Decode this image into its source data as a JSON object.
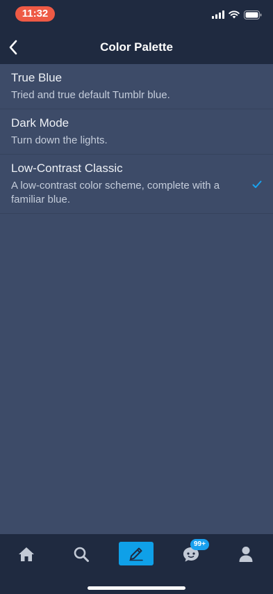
{
  "status_bar": {
    "time": "11:32",
    "icons": [
      "signal-icon",
      "wifi-icon",
      "battery-icon"
    ]
  },
  "nav": {
    "back_icon": "chevron-left-icon",
    "title": "Color Palette"
  },
  "options": [
    {
      "title": "True Blue",
      "description": "Tried and true default Tumblr blue.",
      "selected": false
    },
    {
      "title": "Dark Mode",
      "description": "Turn down the lights.",
      "selected": false
    },
    {
      "title": "Low-Contrast Classic",
      "description": "A low-contrast color scheme, complete with a familiar blue.",
      "selected": true
    }
  ],
  "tab_bar": {
    "tabs": [
      "home-icon",
      "search-icon",
      "compose-icon",
      "activity-icon",
      "account-icon"
    ],
    "activity_badge": "99+"
  },
  "colors": {
    "background": "#3d4b68",
    "bars": "#1f2a40",
    "accent": "#0fa0e8",
    "time_pill": "#ee5a45"
  }
}
